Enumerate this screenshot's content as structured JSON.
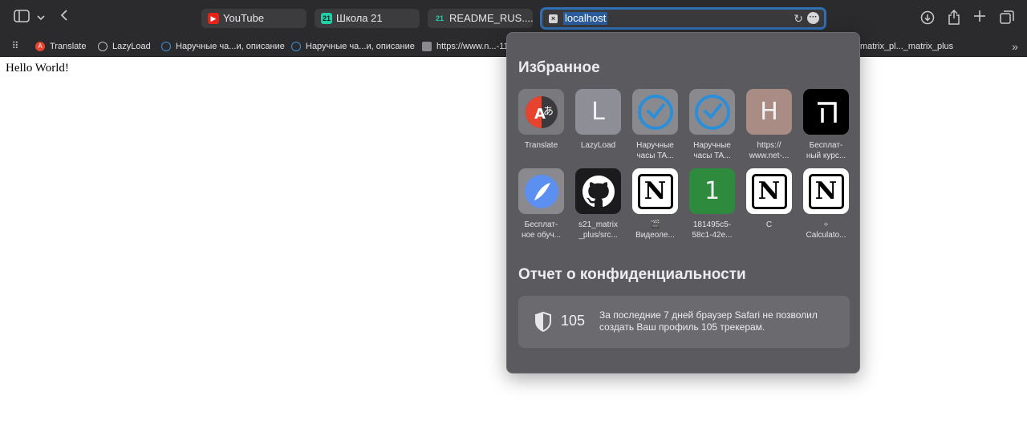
{
  "toolbar": {
    "sidebar_icon": "▯",
    "chevron_icon": "⌄",
    "back_icon": "‹",
    "tabs": [
      {
        "label": "YouTube",
        "icon": "▶",
        "color": "#e62117"
      },
      {
        "label": "Школа 21",
        "icon": "21",
        "color": "#1ed1a7"
      },
      {
        "label": "README_RUS....",
        "icon": "21",
        "color": "#1ed1a7"
      }
    ],
    "url": "localhost",
    "site_icon": "×",
    "reload_icon": "↻",
    "more_icon": "···",
    "download_icon": "⊕",
    "share_icon": "⇪",
    "new_tab_icon": "+",
    "tabs_overview_icon": "⧉"
  },
  "bookmarks": {
    "apps_icon": "⠿",
    "items": [
      {
        "label": "Translate",
        "icon": "A"
      },
      {
        "label": "LazyLoad",
        "icon": "⊕"
      },
      {
        "label": "Наручные ча...и, описание",
        "icon": "◷"
      },
      {
        "label": "Наручные ча...и, описание",
        "icon": "◷"
      },
      {
        "label": "https://www.n...-11",
        "icon": "▦"
      }
    ],
    "right_item": "matrix_pl..._matrix_plus",
    "overflow_icon": "»"
  },
  "page": {
    "text": "Hello World!"
  },
  "popover": {
    "favorites_title": "Избранное",
    "favorites": [
      {
        "caption": "Translate",
        "type": "translate"
      },
      {
        "caption": "LazyLoad",
        "type": "letter",
        "letter": "L",
        "bg": "#8e8e96"
      },
      {
        "caption": "Наручные\nчасы TA...",
        "type": "clock"
      },
      {
        "caption": "Наручные\nчасы TA...",
        "type": "clock"
      },
      {
        "caption": "https://\nwww.net-...",
        "type": "letter",
        "letter": "H",
        "bg": "#a98c83"
      },
      {
        "caption": "Бесплат-\nный курс...",
        "type": "pi"
      },
      {
        "caption": "Бесплат-\nное обуч...",
        "type": "blue"
      },
      {
        "caption": "s21_matrix\n_plus/src...",
        "type": "github"
      },
      {
        "caption": "Видеоле...",
        "type": "notion",
        "pre": "🎬"
      },
      {
        "caption": "181495c5-\n58c1-42e...",
        "type": "letter",
        "letter": "1",
        "bg": "#2e8b3d"
      },
      {
        "caption": "C",
        "type": "notion"
      },
      {
        "caption": "Calculato...",
        "type": "notion",
        "pre": "÷"
      }
    ],
    "privacy_title": "Отчет о конфиденциальности",
    "tracker_count": "105",
    "privacy_text": "За последние 7 дней браузер Safari не позволил создать Ваш профиль 105 трекерам."
  }
}
